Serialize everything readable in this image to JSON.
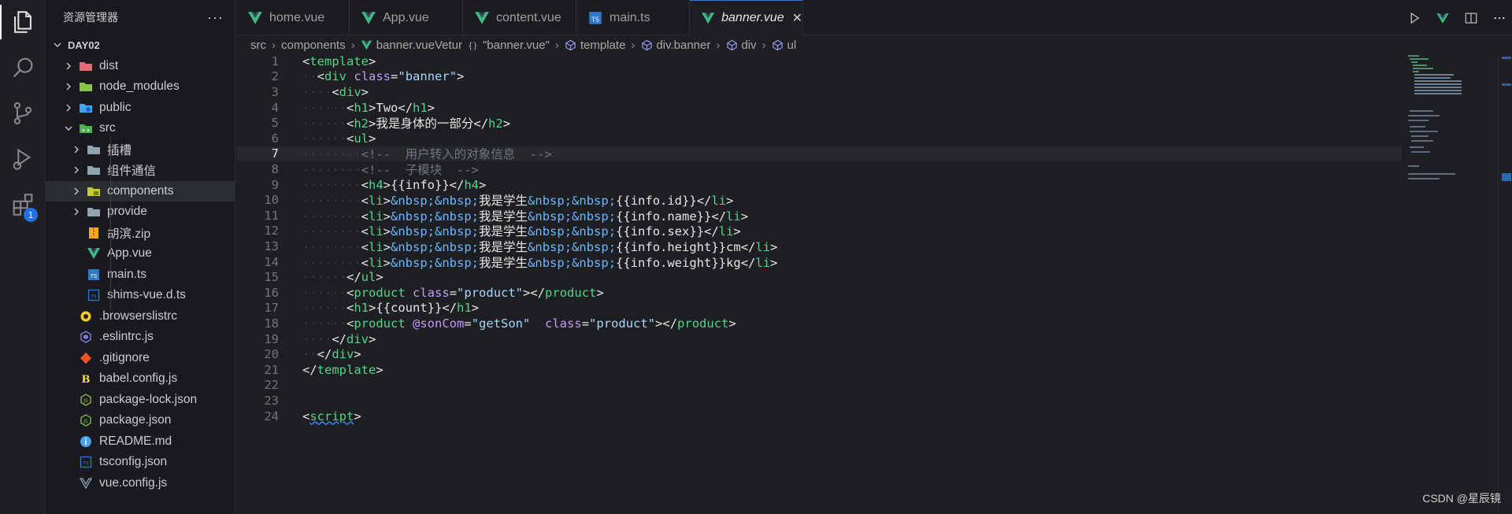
{
  "sidebar": {
    "title": "资源管理器",
    "more": "···",
    "root": "DAY02",
    "items": [
      {
        "label": "dist",
        "type": "folder",
        "level": 1,
        "collapsed": true,
        "icon": "folder-red-icon"
      },
      {
        "label": "node_modules",
        "type": "folder",
        "level": 1,
        "collapsed": true,
        "icon": "folder-green-icon"
      },
      {
        "label": "public",
        "type": "folder",
        "level": 1,
        "collapsed": true,
        "icon": "folder-blue-icon"
      },
      {
        "label": "src",
        "type": "folder",
        "level": 1,
        "collapsed": false,
        "icon": "folder-src-icon"
      },
      {
        "label": "插槽",
        "type": "folder",
        "level": 2,
        "collapsed": true,
        "icon": "folder-icon"
      },
      {
        "label": "组件通信",
        "type": "folder",
        "level": 2,
        "collapsed": true,
        "icon": "folder-icon"
      },
      {
        "label": "components",
        "type": "folder",
        "level": 2,
        "collapsed": true,
        "icon": "folder-components-icon",
        "selected": true
      },
      {
        "label": "provide",
        "type": "folder",
        "level": 2,
        "collapsed": true,
        "icon": "folder-icon"
      },
      {
        "label": "胡滨.zip",
        "type": "file",
        "level": 2,
        "icon": "zip-icon"
      },
      {
        "label": "App.vue",
        "type": "file",
        "level": 2,
        "icon": "vue-icon"
      },
      {
        "label": "main.ts",
        "type": "file",
        "level": 2,
        "icon": "ts-icon"
      },
      {
        "label": "shims-vue.d.ts",
        "type": "file",
        "level": 2,
        "icon": "ts-outline-icon"
      },
      {
        "label": ".browserslistrc",
        "type": "file",
        "level": 1,
        "icon": "browserslist-icon"
      },
      {
        "label": ".eslintrc.js",
        "type": "file",
        "level": 1,
        "icon": "eslint-icon"
      },
      {
        "label": ".gitignore",
        "type": "file",
        "level": 1,
        "icon": "git-icon"
      },
      {
        "label": "babel.config.js",
        "type": "file",
        "level": 1,
        "icon": "babel-icon"
      },
      {
        "label": "package-lock.json",
        "type": "file",
        "level": 1,
        "icon": "node-icon"
      },
      {
        "label": "package.json",
        "type": "file",
        "level": 1,
        "icon": "node-icon"
      },
      {
        "label": "README.md",
        "type": "file",
        "level": 1,
        "icon": "info-icon"
      },
      {
        "label": "tsconfig.json",
        "type": "file",
        "level": 1,
        "icon": "ts-outline-icon"
      },
      {
        "label": "vue.config.js",
        "type": "file",
        "level": 1,
        "icon": "vue-outline-icon"
      }
    ]
  },
  "activity": {
    "extensions_badge": "1"
  },
  "tabs": [
    {
      "label": "home.vue",
      "icon": "vue-icon",
      "active": false
    },
    {
      "label": "App.vue",
      "icon": "vue-icon",
      "active": false
    },
    {
      "label": "content.vue",
      "icon": "vue-icon",
      "active": false
    },
    {
      "label": "main.ts",
      "icon": "ts-icon",
      "active": false
    },
    {
      "label": "banner.vue",
      "icon": "vue-icon",
      "active": true,
      "close": "✕"
    }
  ],
  "breadcrumb": [
    "src",
    "components",
    "banner.vue",
    "Vetur",
    "\"banner.vue\"",
    "template",
    "div.banner",
    "div",
    "ul"
  ],
  "editor": {
    "current_line": 7,
    "lines": [
      "1",
      "2",
      "3",
      "4",
      "5",
      "6",
      "7",
      "8",
      "9",
      "10",
      "11",
      "12",
      "13",
      "14",
      "15",
      "16",
      "17",
      "18",
      "19",
      "20",
      "21",
      "22",
      "23",
      "24"
    ],
    "code": {
      "l4_text": "Two",
      "l5_text": "我是身体的一部分",
      "l7_comment": "<!--  用户转入的对象信息  -->",
      "l8_comment": "<!--  子模块  -->",
      "l9_text": "{{info}}",
      "li_text": "我是学生",
      "l10_expr": "{{info.id}}",
      "l11_expr": "{{info.name}}",
      "l12_expr": "{{info.sex}}",
      "l13_expr": "{{info.height}}",
      "l13_unit": "cm",
      "l14_expr": "{{info.weight}}",
      "l14_unit": "kg",
      "l17_text": "{{count}}",
      "nbsp": "&nbsp;",
      "class_banner": "\"banner\"",
      "class_product": "\"product\"",
      "son_value": "\"getSon\"",
      "son_attr": "@sonCom"
    }
  },
  "watermark": "CSDN @星辰镜",
  "colors": {
    "accent": "#1f6feb",
    "tag": "#57d28b",
    "attr": "#c39af7",
    "string": "#a5d6ff",
    "entity": "#6cb6ff"
  }
}
